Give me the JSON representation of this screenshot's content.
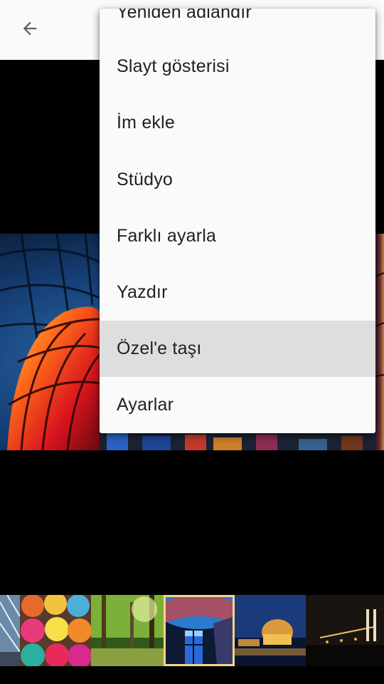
{
  "appbar": {
    "back_icon": "arrow-back-icon"
  },
  "menu": {
    "items": [
      {
        "label": "Yeniden adlandır",
        "highlighted": false
      },
      {
        "label": "Slayt gösterisi",
        "highlighted": false
      },
      {
        "label": "İm ekle",
        "highlighted": false
      },
      {
        "label": "Stüdyo",
        "highlighted": false
      },
      {
        "label": "Farklı ayarla",
        "highlighted": false
      },
      {
        "label": "Yazdır",
        "highlighted": false
      },
      {
        "label": "Özel'e taşı",
        "highlighted": true
      },
      {
        "label": "Ayarlar",
        "highlighted": false
      }
    ]
  },
  "filmstrip": {
    "thumbnails": [
      {
        "subject": "glass-ceiling",
        "selected": false
      },
      {
        "subject": "yarn-balls",
        "selected": false
      },
      {
        "subject": "forest",
        "selected": false
      },
      {
        "subject": "glass-dome",
        "selected": true
      },
      {
        "subject": "palace-night",
        "selected": false
      },
      {
        "subject": "bridge-night",
        "selected": false
      }
    ]
  }
}
